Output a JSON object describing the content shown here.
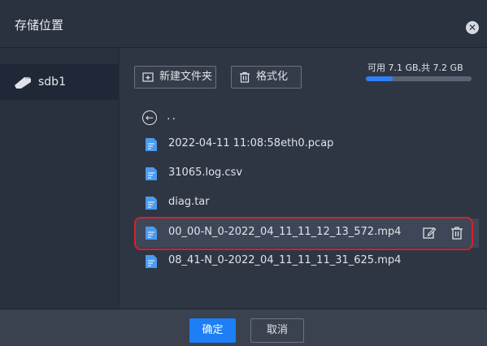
{
  "dialog": {
    "title": "存储位置"
  },
  "sidebar": {
    "drives": [
      {
        "label": "sdb1",
        "icon": "usb-drive-icon"
      }
    ]
  },
  "toolbar": {
    "new_folder_label": "新建文件夹",
    "format_label": "格式化"
  },
  "storage": {
    "text": "可用 7.1 GB,共 7.2 GB",
    "used_fraction": 0.25,
    "fill_color": "#2f7ff5"
  },
  "file_list": {
    "up_label": "..",
    "items": [
      {
        "name": "2022-04-11 11:08:58eth0.pcap"
      },
      {
        "name": "31065.log.csv"
      },
      {
        "name": "diag.tar"
      },
      {
        "name": "00_00-N_0-2022_04_11_11_12_13_572.mp4",
        "selected": true
      },
      {
        "name": "08_41-N_0-2022_04_11_11_11_31_625.mp4"
      }
    ]
  },
  "footer": {
    "confirm_label": "确定",
    "cancel_label": "取消"
  },
  "colors": {
    "accent": "#1d7ef5",
    "highlight_border": "#d8202a",
    "file_icon": "#4a9bf0"
  }
}
